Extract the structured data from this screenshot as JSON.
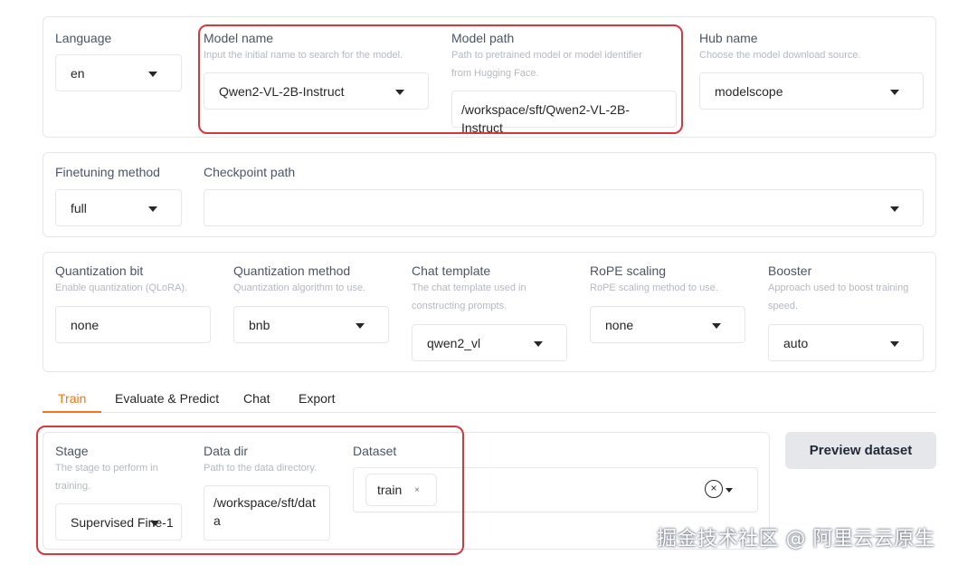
{
  "top_panel": {
    "language": {
      "label": "Language",
      "value": "en"
    },
    "model_name": {
      "label": "Model name",
      "hint": "Input the initial name to search for the model.",
      "value": "Qwen2-VL-2B-Instruct"
    },
    "model_path": {
      "label": "Model path",
      "hint_line1": "Path to pretrained model or model identifier",
      "hint_line2": "from Hugging Face.",
      "value": "/workspace/sft/Qwen2-VL-2B-Instruct"
    },
    "hub_name": {
      "label": "Hub name",
      "hint": "Choose the model download source.",
      "value": "modelscope"
    }
  },
  "finetune_panel": {
    "method": {
      "label": "Finetuning method",
      "value": "full"
    },
    "checkpoint": {
      "label": "Checkpoint path",
      "value": ""
    }
  },
  "quant_panel": {
    "quant_bit": {
      "label": "Quantization bit",
      "hint": "Enable quantization (QLoRA).",
      "value": "none"
    },
    "quant_method": {
      "label": "Quantization method",
      "hint": "Quantization algorithm to use.",
      "value": "bnb"
    },
    "chat_template": {
      "label": "Chat template",
      "hint_line1": "The chat template used in",
      "hint_line2": "constructing prompts.",
      "value": "qwen2_vl"
    },
    "rope": {
      "label": "RoPE scaling",
      "hint": "RoPE scaling method to use.",
      "value": "none"
    },
    "booster": {
      "label": "Booster",
      "hint_line1": "Approach used to boost training",
      "hint_line2": "speed.",
      "value": "auto"
    }
  },
  "tabs": [
    "Train",
    "Evaluate & Predict",
    "Chat",
    "Export"
  ],
  "train_panel": {
    "stage": {
      "label": "Stage",
      "hint_line1": "The stage to perform in",
      "hint_line2": "training.",
      "value": "Supervised Fine-1"
    },
    "data_dir": {
      "label": "Data dir",
      "hint": "Path to the data directory.",
      "value_line1": "/workspace/sft/dat",
      "value_line2": "a"
    },
    "dataset": {
      "label": "Dataset",
      "chip": "train",
      "chip_x": "×",
      "clear": "×"
    },
    "preview_button": "Preview dataset"
  },
  "watermark": "掘金技术社区 @ 阿里云云原生",
  "colors": {
    "accent": "#f97316",
    "highlight": "#d9363e",
    "border": "#e5e7eb"
  }
}
